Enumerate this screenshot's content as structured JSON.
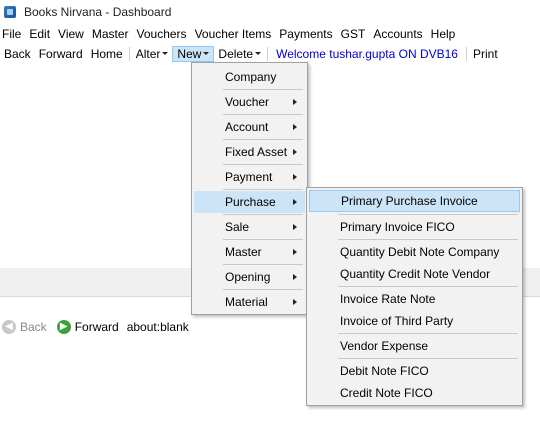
{
  "window": {
    "title": "Books Nirvana - Dashboard"
  },
  "menubar": [
    "File",
    "Edit",
    "View",
    "Master",
    "Vouchers",
    "Voucher Items",
    "Payments",
    "GST",
    "Accounts",
    "Help"
  ],
  "toolbar": {
    "back": "Back",
    "forward": "Forward",
    "home": "Home",
    "alter": "Alter",
    "new": "New",
    "delete": "Delete",
    "welcome": "Welcome tushar.gupta ON DVB16",
    "print": "Print"
  },
  "new_menu": {
    "items": [
      "Company",
      "Voucher",
      "Account",
      "Fixed Asset",
      "Payment",
      "Purchase",
      "Sale",
      "Master",
      "Opening",
      "Material"
    ],
    "active": "Purchase"
  },
  "purchase_menu": {
    "items": [
      "Primary Purchase Invoice",
      "Primary Invoice FICO",
      "Quantity Debit Note Company",
      "Quantity Credit Note Vendor",
      "Invoice Rate Note",
      "Invoice of Third Party",
      "Vendor Expense",
      "Debit Note FICO",
      "Credit Note FICO"
    ],
    "active": "Primary Purchase Invoice"
  },
  "browser_nav": {
    "back": "Back",
    "forward": "Forward",
    "address": "about:blank"
  }
}
